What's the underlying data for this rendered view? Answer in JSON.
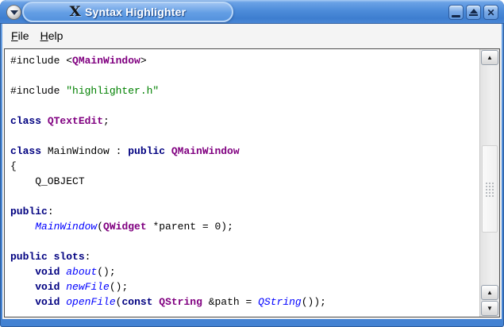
{
  "colors": {
    "keyword": "#000080",
    "qt_class": "#800080",
    "string_lit": "#008000",
    "function": "#0000ff",
    "plain": "#000000",
    "titlebar_blue": "#4886d6",
    "frame_blue": "#4a86d4"
  },
  "window": {
    "title": "Syntax Highlighter",
    "app_icon_glyph": "X"
  },
  "icons": {
    "scroll_up": "▲",
    "scroll_down": "▼",
    "close": "✕"
  },
  "menubar": {
    "items": [
      {
        "label": "File",
        "underline": 0
      },
      {
        "label": "Help",
        "underline": 0
      }
    ]
  },
  "editor": {
    "lines": [
      [
        {
          "s": "p",
          "t": "#include <"
        },
        {
          "s": "c",
          "t": "QMainWindow"
        },
        {
          "s": "p",
          "t": ">"
        }
      ],
      [],
      [
        {
          "s": "p",
          "t": "#include "
        },
        {
          "s": "s",
          "t": "\"highlighter.h\""
        }
      ],
      [],
      [
        {
          "s": "k",
          "t": "class "
        },
        {
          "s": "c",
          "t": "QTextEdit"
        },
        {
          "s": "p",
          "t": ";"
        }
      ],
      [],
      [
        {
          "s": "k",
          "t": "class "
        },
        {
          "s": "p",
          "t": "MainWindow : "
        },
        {
          "s": "k",
          "t": "public "
        },
        {
          "s": "c",
          "t": "QMainWindow"
        }
      ],
      [
        {
          "s": "p",
          "t": "{"
        }
      ],
      [
        {
          "s": "p",
          "t": "    Q_OBJECT"
        }
      ],
      [],
      [
        {
          "s": "k",
          "t": "public"
        },
        {
          "s": "p",
          "t": ":"
        }
      ],
      [
        {
          "s": "p",
          "t": "    "
        },
        {
          "s": "f",
          "t": "MainWindow"
        },
        {
          "s": "p",
          "t": "("
        },
        {
          "s": "c",
          "t": "QWidget"
        },
        {
          "s": "p",
          "t": " *parent = 0);"
        }
      ],
      [],
      [
        {
          "s": "k",
          "t": "public slots"
        },
        {
          "s": "p",
          "t": ":"
        }
      ],
      [
        {
          "s": "p",
          "t": "    "
        },
        {
          "s": "k",
          "t": "void "
        },
        {
          "s": "f",
          "t": "about"
        },
        {
          "s": "p",
          "t": "();"
        }
      ],
      [
        {
          "s": "p",
          "t": "    "
        },
        {
          "s": "k",
          "t": "void "
        },
        {
          "s": "f",
          "t": "newFile"
        },
        {
          "s": "p",
          "t": "();"
        }
      ],
      [
        {
          "s": "p",
          "t": "    "
        },
        {
          "s": "k",
          "t": "void "
        },
        {
          "s": "f",
          "t": "openFile"
        },
        {
          "s": "p",
          "t": "("
        },
        {
          "s": "k",
          "t": "const "
        },
        {
          "s": "c",
          "t": "QString"
        },
        {
          "s": "p",
          "t": " &path = "
        },
        {
          "s": "f",
          "t": "QString"
        },
        {
          "s": "p",
          "t": "());"
        }
      ]
    ]
  }
}
